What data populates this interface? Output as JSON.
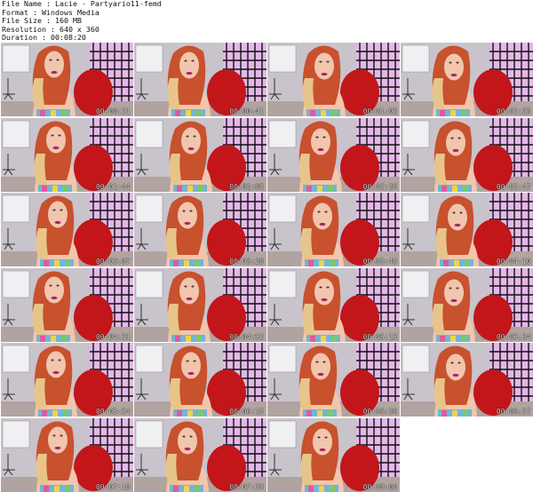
{
  "info": {
    "file_name_label": "File Name",
    "file_name": "Lacie - Partyario11-femd",
    "format_label": "Format",
    "format": "Windows Media",
    "file_size_label": "File Size",
    "file_size": "160 MB",
    "resolution_label": "Resolution",
    "resolution": "640 x 360",
    "duration_label": "Duration",
    "duration": "00:08:20"
  },
  "thumbnails": [
    {
      "timestamp": "00:00:21"
    },
    {
      "timestamp": "00:00:41"
    },
    {
      "timestamp": "00:01:02"
    },
    {
      "timestamp": "00:01:23"
    },
    {
      "timestamp": "00:01:44"
    },
    {
      "timestamp": "00:02:05"
    },
    {
      "timestamp": "00:02:26"
    },
    {
      "timestamp": "00:02:47"
    },
    {
      "timestamp": "00:03:07"
    },
    {
      "timestamp": "00:03:28"
    },
    {
      "timestamp": "00:03:49"
    },
    {
      "timestamp": "00:04:10"
    },
    {
      "timestamp": "00:04:31"
    },
    {
      "timestamp": "00:04:52"
    },
    {
      "timestamp": "00:05:13"
    },
    {
      "timestamp": "00:05:34"
    },
    {
      "timestamp": "00:05:54"
    },
    {
      "timestamp": "00:06:15"
    },
    {
      "timestamp": "00:06:36"
    },
    {
      "timestamp": "00:06:57"
    },
    {
      "timestamp": "00:07:18"
    },
    {
      "timestamp": "00:07:39"
    },
    {
      "timestamp": "00:08:00"
    }
  ],
  "colors": {
    "background": "#ffffff",
    "room_wall": "#c9c3cb",
    "floor": "#b1a39f",
    "whiteboard": "#f0f0f2",
    "divider_screen": "#111111",
    "divider_glow": "#e3b8e8",
    "red_chair": "#c2161b",
    "skin": "#f1c6ad",
    "hair_red": "#c8512e",
    "hair_blonde": "#e7c58a",
    "top_pattern": "#6fb6d8",
    "lipstick": "#b0216b"
  },
  "icons": {
    "office_chair": "office-chair-icon",
    "whiteboard": "whiteboard-icon",
    "folding_screen": "folding-screen-icon"
  }
}
